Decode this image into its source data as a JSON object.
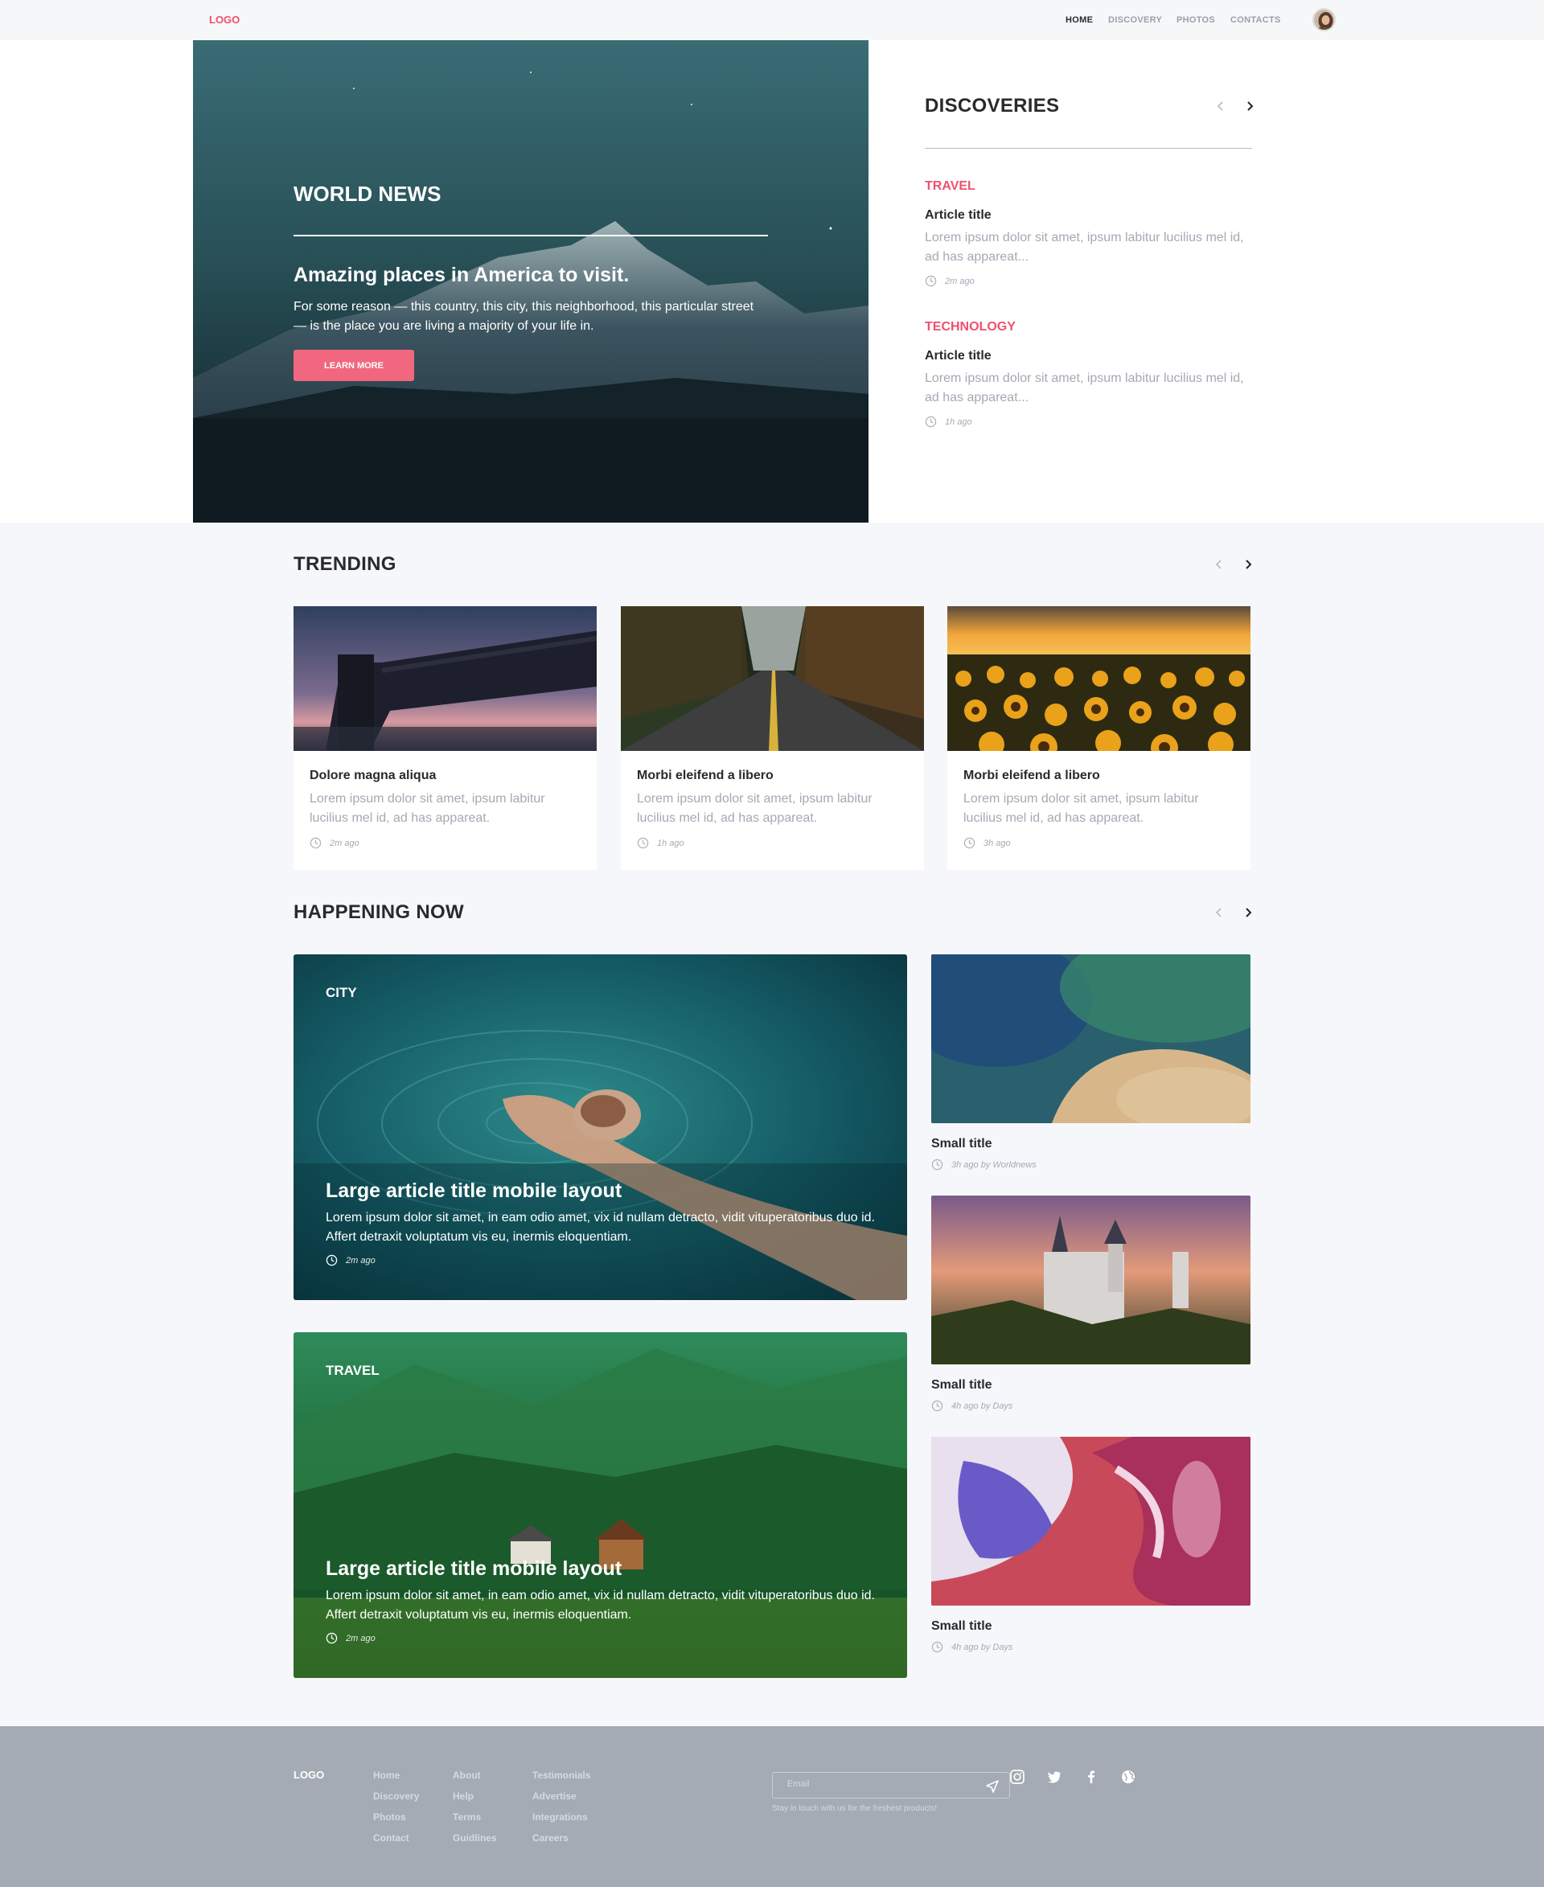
{
  "nav": {
    "logo": "LOGO",
    "links": [
      "HOME",
      "DISCOVERY",
      "PHOTOS",
      "CONTACTS"
    ]
  },
  "hero": {
    "label": "WORLD NEWS",
    "title": "Amazing places in America to visit.",
    "text": "For some reason — this country, this city, this neighborhood, this particular street — is the place you are living a majority of your life in.",
    "button": "LEARN MORE"
  },
  "discoveries": {
    "title": "DISCOVERIES",
    "items": [
      {
        "category": "TRAVEL",
        "title": "Article title",
        "text": "Lorem ipsum dolor sit amet, ipsum labitur lucilius mel id, ad has appareat...",
        "time": "2m ago"
      },
      {
        "category": "TECHNOLOGY",
        "title": "Article title",
        "text": "Lorem ipsum dolor sit amet, ipsum labitur lucilius mel id, ad has appareat...",
        "time": "1h ago"
      }
    ]
  },
  "trending": {
    "title": "TRENDING",
    "cards": [
      {
        "title": "Dolore magna aliqua",
        "text": "Lorem ipsum dolor sit amet, ipsum labitur lucilius mel id, ad has appareat.",
        "time": "2m ago"
      },
      {
        "title": "Morbi eleifend a libero",
        "text": "Lorem ipsum dolor sit amet, ipsum labitur lucilius mel id, ad has appareat.",
        "time": "1h ago"
      },
      {
        "title": "Morbi eleifend a libero",
        "text": "Lorem ipsum dolor sit amet, ipsum labitur lucilius mel id, ad has appareat.",
        "time": "3h ago"
      }
    ]
  },
  "happening": {
    "title": "HAPPENING NOW",
    "large": [
      {
        "category": "CITY",
        "title": "Large article title mobile layout",
        "text": "Lorem ipsum dolor sit amet, in eam odio amet, vix id nullam detracto, vidit vituperatoribus duo id. Affert detraxit voluptatum vis eu, inermis eloquentiam.",
        "time": "2m ago"
      },
      {
        "category": "TRAVEL",
        "title": "Large article title mobile layout",
        "text": "Lorem ipsum dolor sit amet, in eam odio amet, vix id nullam detracto, vidit vituperatoribus duo id. Affert detraxit voluptatum vis eu, inermis eloquentiam.",
        "time": "2m ago"
      }
    ],
    "small": [
      {
        "title": "Small title",
        "meta": "3h ago by Worldnews"
      },
      {
        "title": "Small title",
        "meta": "4h ago by Days"
      },
      {
        "title": "Small title",
        "meta": "4h ago by Days"
      }
    ]
  },
  "footer": {
    "logo": "LOGO",
    "col1": [
      "Home",
      "Discovery",
      "Photos",
      "Contact"
    ],
    "col2": [
      "About",
      "Help",
      "Terms",
      "Guidlines"
    ],
    "col3": [
      "Testimonials",
      "Advertise",
      "Integrations",
      "Careers"
    ],
    "email_placeholder": "Email",
    "note": "Stay in touch with us for the freshest products!",
    "social_icons": [
      "instagram-icon",
      "twitter-icon",
      "facebook-icon",
      "globe-icon"
    ]
  },
  "colors": {
    "accent": "#f0506e",
    "button": "#f0677f",
    "footer": "#a4abb4",
    "muted": "#a4a9b3"
  }
}
